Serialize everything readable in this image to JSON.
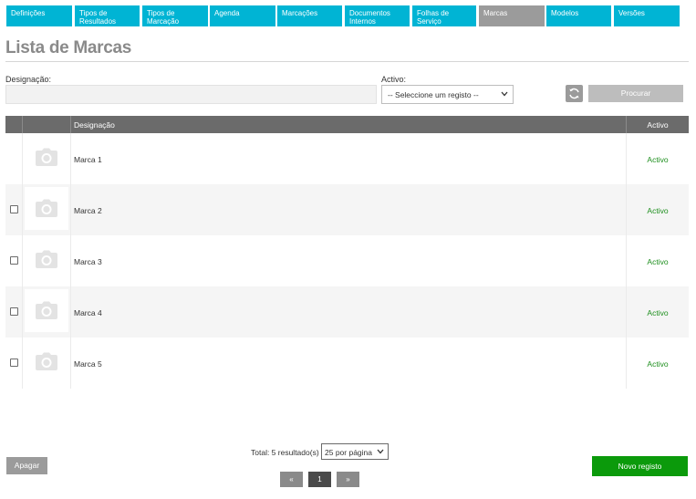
{
  "nav": {
    "tabs": [
      {
        "label": "Definições",
        "active": false
      },
      {
        "label": "Tipos de Resultados",
        "active": false
      },
      {
        "label": "Tipos de Marcação",
        "active": false
      },
      {
        "label": "Agenda",
        "active": false
      },
      {
        "label": "Marcações",
        "active": false
      },
      {
        "label": "Documentos Internos",
        "active": false
      },
      {
        "label": "Folhas de Serviço",
        "active": false
      },
      {
        "label": "Marcas",
        "active": true
      },
      {
        "label": "Modelos",
        "active": false
      },
      {
        "label": "Versões",
        "active": false
      }
    ]
  },
  "page": {
    "title": "Lista de Marcas"
  },
  "filters": {
    "designacao_label": "Designação:",
    "designacao_value": "",
    "activo_label": "Activo:",
    "activo_selected": "-- Seleccione um registo --",
    "search_label": "Procurar"
  },
  "table": {
    "headers": {
      "name": "Designação",
      "active": "Activo"
    },
    "rows": [
      {
        "name": "Marca 1",
        "status": "Activo",
        "has_checkbox": false
      },
      {
        "name": "Marca 2",
        "status": "Activo",
        "has_checkbox": true
      },
      {
        "name": "Marca 3",
        "status": "Activo",
        "has_checkbox": true
      },
      {
        "name": "Marca 4",
        "status": "Activo",
        "has_checkbox": true
      },
      {
        "name": "Marca 5",
        "status": "Activo",
        "has_checkbox": true
      }
    ]
  },
  "footer": {
    "total_text": "Total: 5 resultado(s)",
    "per_page_selected": "25 por página",
    "pager": {
      "prev": "«",
      "current": "1",
      "next": "»"
    },
    "delete_label": "Apagar",
    "new_label": "Novo registo"
  },
  "colors": {
    "tab": "#00b4d4",
    "tab_active": "#9b9b9b",
    "status_active": "#1e8f1e",
    "new_button": "#0b9a0b"
  },
  "icons": {
    "refresh": "refresh-icon",
    "photo_placeholder": "camera-icon",
    "select_caret": "chevron-down-icon"
  }
}
